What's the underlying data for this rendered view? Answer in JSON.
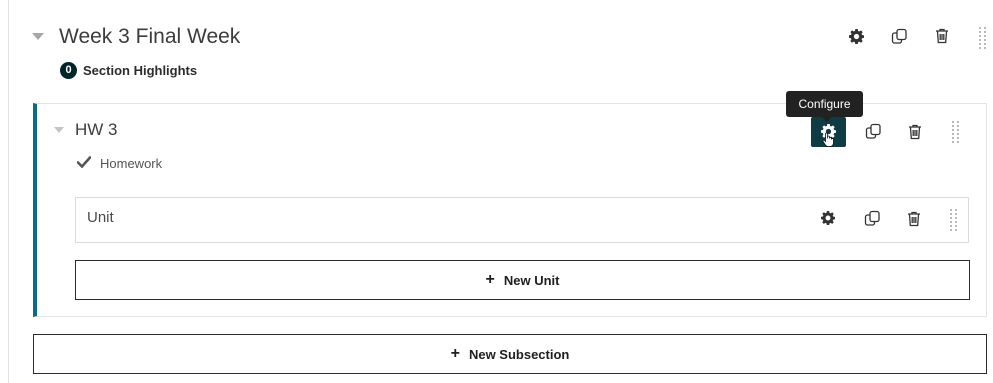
{
  "section": {
    "title": "Week 3 Final Week",
    "highlights_count": "0",
    "highlights_label": "Section Highlights",
    "icons": [
      "gear-icon",
      "copy-icon",
      "trash-icon",
      "drag-handle-icon"
    ]
  },
  "subsection": {
    "title": "HW 3",
    "status_label": "Homework",
    "tooltip": "Configure",
    "accent_color": "#0a6a8a",
    "active_gear_bg": "#0f3c44"
  },
  "unit": {
    "title": "Unit"
  },
  "buttons": {
    "new_unit": "New Unit",
    "new_subsection": "New Subsection",
    "plus": "+"
  },
  "colors": {
    "badge_bg": "#00262b",
    "tooltip_bg": "#222222"
  }
}
